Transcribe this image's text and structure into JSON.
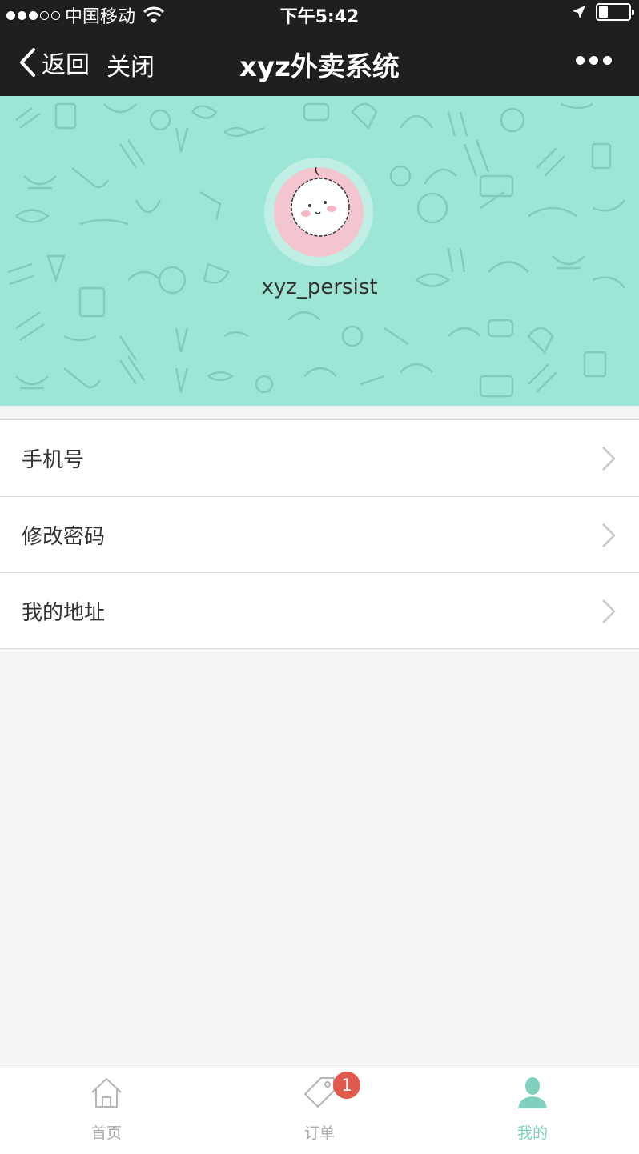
{
  "status_bar": {
    "carrier": "中国移动",
    "time": "下午5:42"
  },
  "nav": {
    "back_label": "返回",
    "close_label": "关闭",
    "title": "xyz外卖系统"
  },
  "profile": {
    "username": "xyz_persist"
  },
  "menu": {
    "items": [
      {
        "label": "手机号"
      },
      {
        "label": "修改密码"
      },
      {
        "label": "我的地址"
      }
    ]
  },
  "tab_bar": {
    "tabs": [
      {
        "label": "首页",
        "icon": "home-icon"
      },
      {
        "label": "订单",
        "icon": "tag-icon",
        "badge": "1"
      },
      {
        "label": "我的",
        "icon": "user-icon"
      }
    ],
    "active_index": 2
  },
  "colors": {
    "nav_bg": "#1f1f22",
    "banner_bg": "#9de6d6",
    "accent": "#7fd1bd",
    "badge": "#e05a4d"
  },
  "battery_level": 0.3
}
